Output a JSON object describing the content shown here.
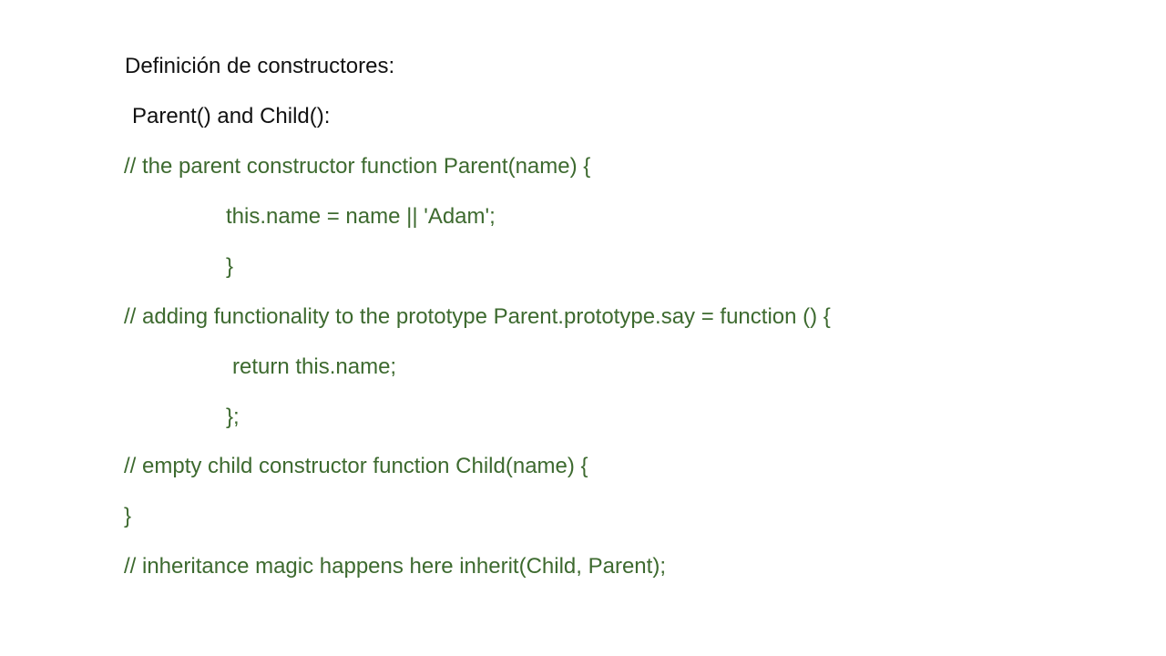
{
  "slide": {
    "heading": "Definición de constructores:",
    "subheading": "Parent() and Child():",
    "code_lines": [
      "// the parent constructor function Parent(name) {",
      "this.name = name || 'Adam';",
      "}",
      "// adding functionality to the prototype Parent.prototype.say = function () {",
      "return this.name;",
      "};",
      "// empty child constructor function Child(name) {",
      "}",
      "// inheritance magic happens here inherit(Child, Parent);"
    ],
    "colors": {
      "heading": "#111111",
      "code": "#3d6a2f",
      "background": "#ffffff"
    }
  }
}
